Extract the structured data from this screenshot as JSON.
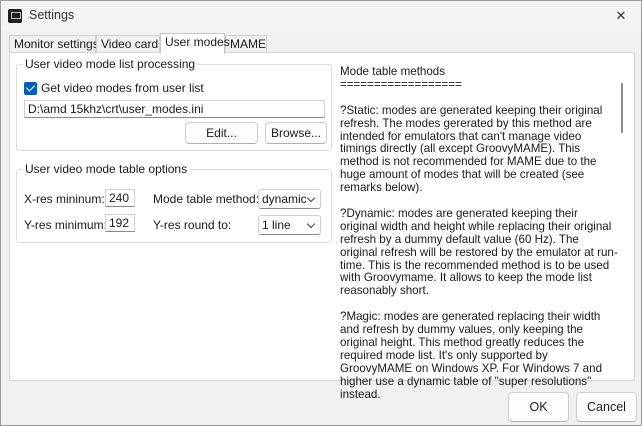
{
  "window": {
    "title": "Settings",
    "close_glyph": "✕"
  },
  "tabs": [
    {
      "label": "Monitor settings"
    },
    {
      "label": "Video card"
    },
    {
      "label": "User modes"
    },
    {
      "label": "MAME"
    }
  ],
  "processing": {
    "title": "User video mode list processing",
    "checkbox_label": "Get video modes from user list",
    "checked": true,
    "path": "D:\\amd 15khz\\crt\\user_modes.ini",
    "edit_label": "Edit...",
    "browse_label": "Browse..."
  },
  "table_options": {
    "title": "User video mode table options",
    "xres_label": "X-res mininum:",
    "xres_value": "240",
    "yres_label": "Y-res minimum:",
    "yres_value": "192",
    "method_label": "Mode table method:",
    "method_value": "dynamic",
    "round_label": "Y-res round to:",
    "round_value": "1 line"
  },
  "description": {
    "title": "Mode table methods",
    "underline": "==================",
    "static": "?Static: modes are generated keeping their original refresh. The modes gererated by this method are intended for emulators that can't manage video timings directly (all except GroovyMAME). This method is not recommended for MAME due to the huge amount of modes that will be created (see remarks below).",
    "dynamic": "?Dynamic: modes are generated keeping their original width and height while replacing their original refresh by a dummy default value (60 Hz). The original refresh will be restored by the emulator at run-time. This is the recommended method is to be used with Groovymame. It allows to keep the mode list reasonably short.",
    "magic": "?Magic: modes are generated replacing their width and refresh by dummy values, only keeping the original height. This method greatly reduces the required mode list. It's only supported by GroovyMAME on Windows XP. For Windows 7 and higher use a dynamic table of \"super resolutions\" instead."
  },
  "footer": {
    "ok_label": "OK",
    "cancel_label": "Cancel"
  }
}
